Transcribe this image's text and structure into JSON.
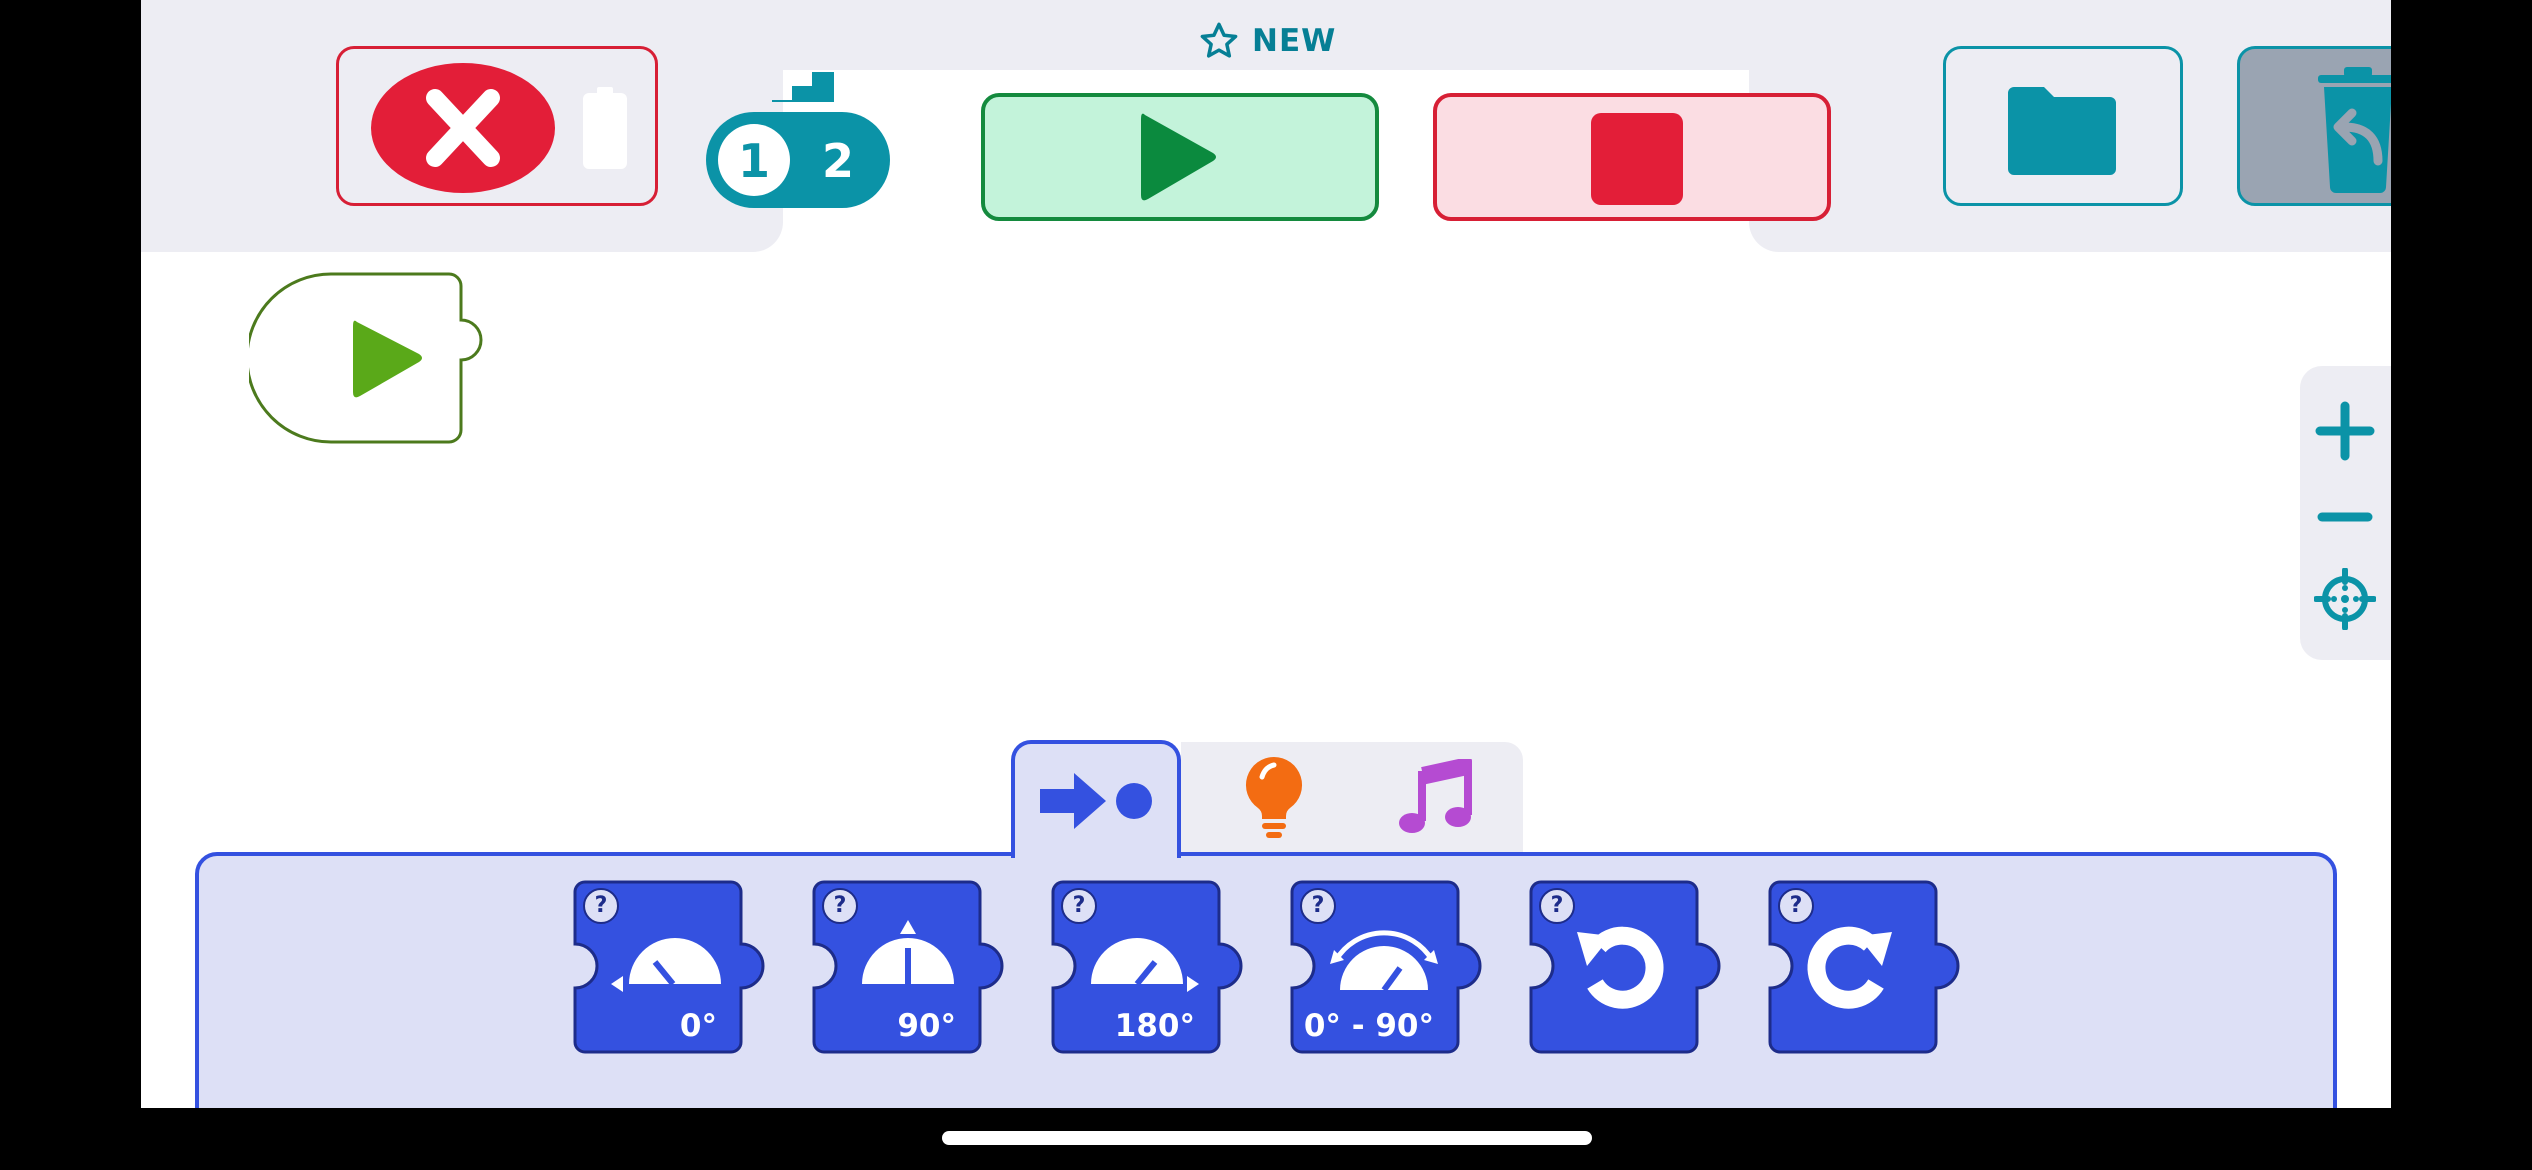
{
  "project": {
    "title": "NEW"
  },
  "toolbar": {
    "badge_left": "1",
    "badge_right": "2"
  },
  "palette": {
    "tabs": [
      {
        "name": "motion",
        "icon": "arrow-dot-icon",
        "active": true,
        "color": "#3451e0"
      },
      {
        "name": "light",
        "icon": "lightbulb-icon",
        "active": false,
        "color": "#f36c12"
      },
      {
        "name": "sound",
        "icon": "music-note-icon",
        "active": false,
        "color": "#b54bd2"
      }
    ],
    "blocks": [
      {
        "icon": "gauge-left-icon",
        "label": "0°",
        "help": "?"
      },
      {
        "icon": "gauge-up-icon",
        "label": "90°",
        "help": "?"
      },
      {
        "icon": "gauge-right-icon",
        "label": "180°",
        "help": "?"
      },
      {
        "icon": "gauge-range-icon",
        "label": "0° - 90°",
        "help": "?"
      },
      {
        "icon": "rotate-counterclockwise-icon",
        "label": "",
        "help": "?"
      },
      {
        "icon": "rotate-clockwise-icon",
        "label": "",
        "help": "?"
      }
    ]
  },
  "colors": {
    "accent_teal": "#0b93a7",
    "play_green": "#148a3e",
    "stop_red": "#e31e38",
    "block_blue": "#3451e0",
    "start_green": "#5aa919"
  }
}
